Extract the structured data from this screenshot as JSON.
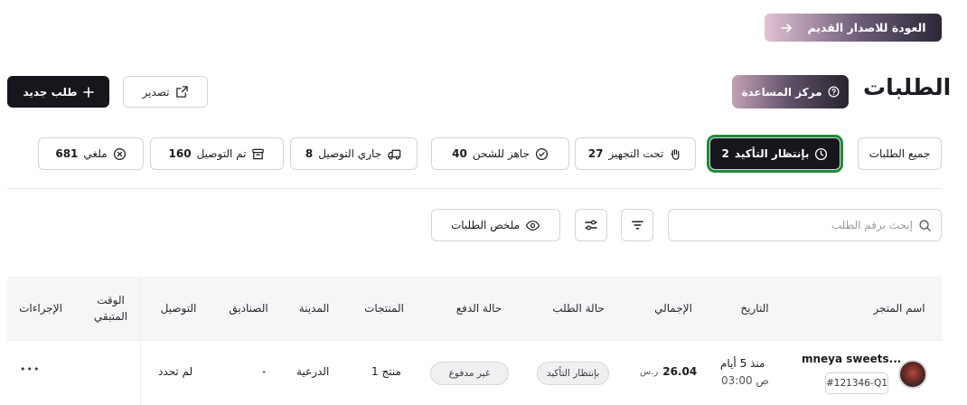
{
  "header": {
    "back_label": "العودة للاصدار القديم",
    "title": "الطلبات",
    "help_label": "مركز المساعدة",
    "export_label": "تصدير",
    "new_order_label": "طلب جديد"
  },
  "tabs": [
    {
      "label": "جميع الطلبات",
      "count": "",
      "icon": "none"
    },
    {
      "label": "بإنتظار التأكيد",
      "count": "2",
      "icon": "clock-icon",
      "active": true
    },
    {
      "label": "تحت التجهيز",
      "count": "27",
      "icon": "hand-icon"
    },
    {
      "label": "جاهز للشحن",
      "count": "40",
      "icon": "check-circle-icon"
    },
    {
      "label": "جاري التوصيل",
      "count": "8",
      "icon": "truck-icon"
    },
    {
      "label": "تم التوصيل",
      "count": "160",
      "icon": "archive-icon"
    },
    {
      "label": "ملغي",
      "count": "681",
      "icon": "x-circle-icon"
    }
  ],
  "toolbar": {
    "search_placeholder": "إبحث برقم الطلب",
    "summary_label": "ملخص الطلبات"
  },
  "table": {
    "columns": {
      "store": "اسم المتجر",
      "date": "التاريخ",
      "total": "الإجمالي",
      "status": "حالة الطلب",
      "payment": "حالة الدفع",
      "products": "المنتجات",
      "city": "المدينة",
      "boxes": "الصناديق",
      "delivery": "التوصيل",
      "remaining_line1": "الوقت",
      "remaining_line2": "المتبقي",
      "actions": "الإجراءات"
    },
    "rows": [
      {
        "store": "mneya sweets...",
        "order_id": "#121346-Q1",
        "date_line1": "منذ 5 أيام",
        "date_line2": "03:00 ص",
        "total_amount": "26.04",
        "total_currency": "ر.س",
        "status": "بإنتظار التأكيد",
        "payment": "غير مدفوع",
        "products": "1 منتج",
        "city": "الدرعية",
        "boxes": "-",
        "delivery": "لم تحدد",
        "remaining": "",
        "actions": "•••"
      }
    ]
  },
  "colors": {
    "primary": "#16161c",
    "active_outline": "#1d8c3a",
    "border": "#d4d4d8",
    "table_head_bg": "#f6f6f8"
  }
}
